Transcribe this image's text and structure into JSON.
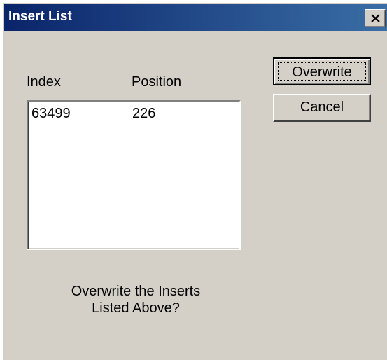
{
  "window": {
    "title": "Insert List",
    "close_icon": "close-icon"
  },
  "list": {
    "columns": [
      "Index",
      "Position"
    ],
    "rows": [
      {
        "index": "63499",
        "position": "226"
      }
    ]
  },
  "buttons": {
    "overwrite_label": "Overwrite",
    "cancel_label": "Cancel"
  },
  "prompt": {
    "line1": "Overwrite the Inserts",
    "line2": "Listed Above?"
  },
  "colors": {
    "titlebar": "#0a246a",
    "dialog_face": "#d4d0c8",
    "list_background": "#ffffff"
  }
}
